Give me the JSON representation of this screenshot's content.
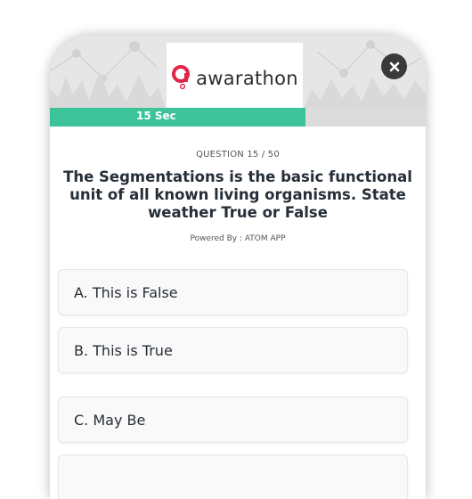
{
  "brand": {
    "logo_text": "awarathon",
    "accent_color": "#e3244a"
  },
  "header": {
    "close_icon": "close-icon"
  },
  "timer": {
    "label": "15 Sec",
    "progress_fraction": 0.68,
    "color": "#3cc39a"
  },
  "question": {
    "counter": "QUESTION 15 / 50",
    "text": "The Segmentations is the basic functional unit of all known living organisms. State weather True or False",
    "powered_by": "Powered By : ATOM APP"
  },
  "options": [
    {
      "label": "A. This is False"
    },
    {
      "label": "B. This is True"
    },
    {
      "label": "C. May Be"
    },
    {
      "label": ""
    }
  ]
}
